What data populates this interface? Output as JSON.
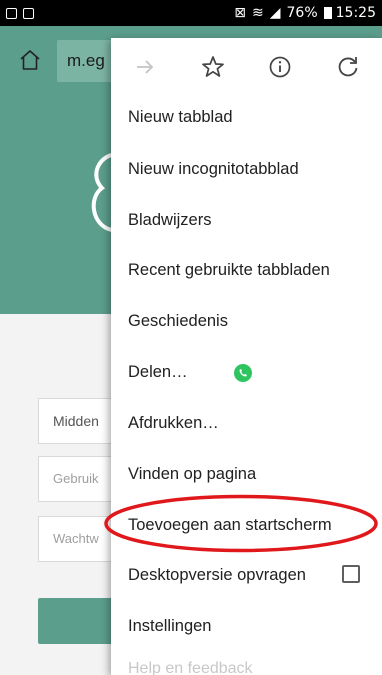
{
  "status_bar": {
    "time": "15:25",
    "battery": "76%"
  },
  "toolbar": {
    "url": "m.eg"
  },
  "page": {
    "field_1": "Midden",
    "field_2_placeholder": "Gebruik",
    "field_3_placeholder": "Wachtw"
  },
  "menu": {
    "items": [
      "Nieuw tabblad",
      "Nieuw incognitotabblad",
      "Bladwijzers",
      "Recent gebruikte tabbladen",
      "Geschiedenis",
      "Delen…",
      "Afdrukken…",
      "Vinden op pagina",
      "Toevoegen aan startscherm",
      "Desktopversie opvragen",
      "Instellingen",
      "Help en feedback"
    ],
    "desktop_checked": false,
    "highlight_color": "#e0181b"
  },
  "colors": {
    "brand_teal": "#5c9e8c",
    "url_bg": "#7cb4a4"
  }
}
